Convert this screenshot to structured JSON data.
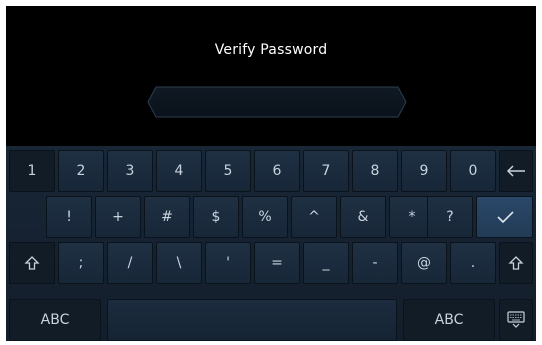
{
  "title": "Verify Password",
  "password_field": {
    "value": ""
  },
  "keyboard": {
    "row1": [
      "1",
      "2",
      "3",
      "4",
      "5",
      "6",
      "7",
      "8",
      "9",
      "0"
    ],
    "row2": [
      "!",
      "+",
      "#",
      "$",
      "%",
      "^",
      "&",
      "*",
      "?"
    ],
    "row3": [
      ";",
      "/",
      "\\",
      "'",
      "=",
      "_",
      "-",
      "@",
      "."
    ],
    "abc_left": "ABC",
    "abc_right": "ABC",
    "icons": {
      "backspace": "left-arrow-icon",
      "confirm": "check-icon",
      "shift": "shift-up-arrow-icon",
      "hide": "keyboard-hide-icon"
    },
    "colors": {
      "accent_key": "#2a4869",
      "key_text": "#c9d3de",
      "background": "#000000"
    }
  }
}
